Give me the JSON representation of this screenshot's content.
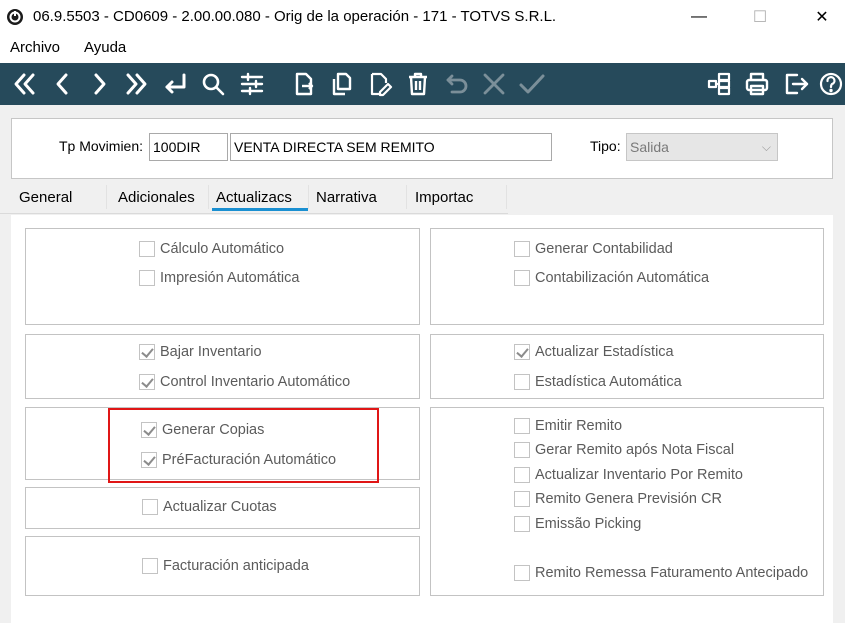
{
  "window": {
    "title": "06.9.5503 - CD0609 - 2.00.00.080 - Orig de la operación - 171 - TOTVS S.R.L.",
    "minimize_glyph": "—",
    "maximize_glyph": "☐",
    "close_glyph": "✕"
  },
  "menu": {
    "items": [
      "Archivo",
      "Ayuda"
    ]
  },
  "toolbar": {
    "icons": [
      "first-icon",
      "previous-icon",
      "next-icon",
      "last-icon",
      "goto-icon",
      "search-icon",
      "filter-icon",
      "new-icon",
      "copy-icon",
      "edit-icon",
      "delete-icon",
      "undo-icon",
      "cancel-icon",
      "save-icon",
      "structure-icon",
      "print-icon",
      "exit-icon",
      "help-icon"
    ],
    "bg_color": "#264a5b"
  },
  "header": {
    "tp_movimiento_label": "Tp Movimien:",
    "tp_movimiento_code": "100DIR",
    "tp_movimiento_desc": "VENTA  DIRECTA SEM REMITO",
    "tipo_label": "Tipo:",
    "tipo_value": "Salida"
  },
  "tabs": {
    "items": [
      "General",
      "Adicionales",
      "Actualizacs",
      "Narrativa",
      "Importac"
    ],
    "active": "Actualizacs",
    "accent": "#1a8fd1"
  },
  "checkboxes": {
    "calculo_automatico": {
      "label": "Cálculo Automático",
      "checked": false
    },
    "impresion_automatica": {
      "label": "Impresión Automática",
      "checked": false
    },
    "generar_contabilidad": {
      "label": "Generar Contabilidad",
      "checked": false
    },
    "contabilizacion_automatica": {
      "label": "Contabilización Automática",
      "checked": false
    },
    "bajar_inventario": {
      "label": "Bajar Inventario",
      "checked": true
    },
    "control_inventario_automatico": {
      "label": "Control Inventario Automático",
      "checked": true
    },
    "actualizar_estadistica": {
      "label": "Actualizar Estadística",
      "checked": true
    },
    "estadistica_automatica": {
      "label": "Estadística Automática",
      "checked": false
    },
    "generar_copias": {
      "label": "Generar Copias",
      "checked": true
    },
    "prefacturacion_automatico": {
      "label": "PréFacturación Automático",
      "checked": true
    },
    "emitir_remito": {
      "label": "Emitir Remito",
      "checked": false
    },
    "gerar_remito_apos_nota_fiscal": {
      "label": "Gerar Remito após Nota Fiscal",
      "checked": false
    },
    "actualizar_inventario_por_remito": {
      "label": "Actualizar Inventario Por Remito",
      "checked": false
    },
    "remito_genera_prevision_cr": {
      "label": "Remito Genera Previsión CR",
      "checked": false
    },
    "emissao_picking": {
      "label": "Emissão Picking",
      "checked": false
    },
    "actualizar_cuotas": {
      "label": "Actualizar Cuotas",
      "checked": false
    },
    "facturacion_anticipada": {
      "label": "Facturación anticipada",
      "checked": false
    },
    "remito_remessa_faturamento_antecipado": {
      "label": "Remito Remessa Faturamento Antecipado",
      "checked": false
    }
  },
  "highlight_color": "#e01616"
}
